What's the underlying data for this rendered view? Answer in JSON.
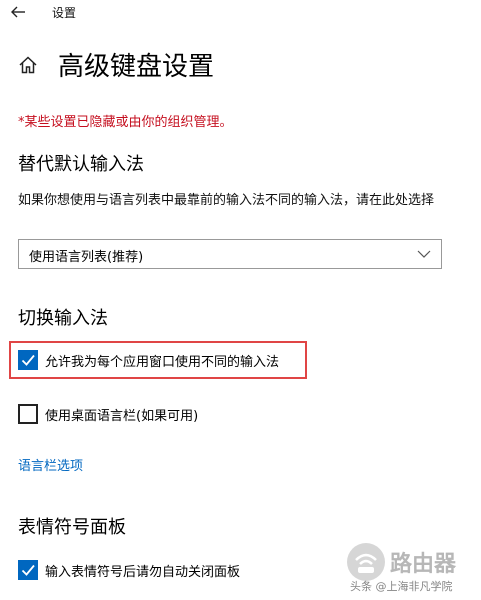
{
  "titlebar": {
    "app_title": "设置"
  },
  "page": {
    "title": "高级键盘设置",
    "org_notice": "*某些设置已隐藏或由你的组织管理。"
  },
  "override_input": {
    "title": "替代默认输入法",
    "description": "如果你想使用与语言列表中最靠前的输入法不同的输入法，请在此处选择",
    "dropdown_value": "使用语言列表(推荐)"
  },
  "switch_input": {
    "title": "切换输入法",
    "options": [
      {
        "label": "允许我为每个应用窗口使用不同的输入法",
        "checked": true
      },
      {
        "label": "使用桌面语言栏(如果可用)",
        "checked": false
      }
    ],
    "link": "语言栏选项"
  },
  "emoji_panel": {
    "title": "表情符号面板",
    "options": [
      {
        "label": "输入表情符号后请勿自动关闭面板",
        "checked": true
      }
    ]
  },
  "watermark": {
    "title": "路由器",
    "sub": "头条 @上海非凡学院"
  },
  "colors": {
    "accent": "#0067c0",
    "notice": "#c50f1f",
    "highlight": "#e04545"
  },
  "icons": {
    "back": "back-arrow-icon",
    "home": "home-icon",
    "dropdown": "chevron-down-icon",
    "check": "checkmark-icon"
  }
}
